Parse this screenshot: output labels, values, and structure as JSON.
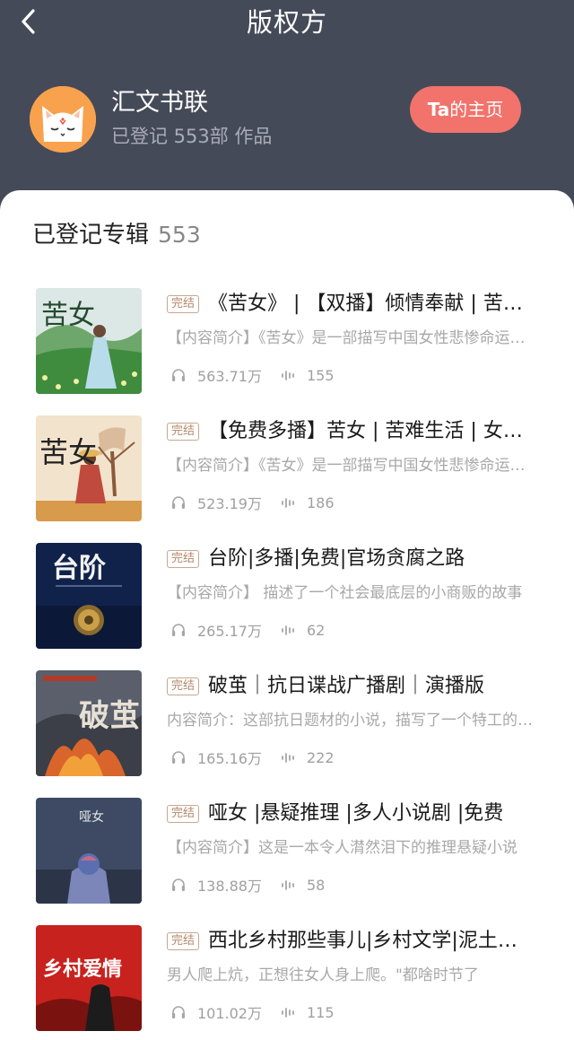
{
  "header": {
    "title": "版权方",
    "owner_name": "汇文书联",
    "owner_registered": "已登记 553部 作品",
    "home_button_bold": "Ta",
    "home_button_rest": "的主页"
  },
  "section": {
    "title": "已登记专辑",
    "count": "553"
  },
  "colors": {
    "header_bg": "#454a59",
    "accent_button": "#f1736b",
    "avatar_bg": "#f8a24e",
    "badge_border": "#c9a68d"
  },
  "icons": {
    "back": "chevron-left-icon",
    "plays": "headphones-icon",
    "tracks": "audio-wave-icon"
  },
  "albums": [
    {
      "badge": "完结",
      "title": "《苦女》 | 【双播】倾情奉献 | 苦难生活",
      "desc": "【内容简介】《苦女》是一部描写中国女性悲惨命运的小说",
      "plays": "563.71万",
      "tracks": "155",
      "cover_text": "苦女"
    },
    {
      "badge": "完结",
      "title": "【免费多播】苦女 | 苦难生活 | 女性命运",
      "desc": "【内容简介】《苦女》是一部描写中国女性悲惨命运的小说",
      "plays": "523.19万",
      "tracks": "186",
      "cover_text": "苦女"
    },
    {
      "badge": "完结",
      "title": "台阶|多播|免费|官场贪腐之路",
      "desc": "【内容简介】 描述了一个社会最底层的小商贩的故事",
      "plays": "265.17万",
      "tracks": "62",
      "cover_text": "台阶"
    },
    {
      "badge": "完结",
      "title": "破茧｜抗日谍战广播剧｜演播版",
      "desc": "内容简介：这部抗日题材的小说，描写了一个特工的故事",
      "plays": "165.16万",
      "tracks": "222",
      "cover_text": "破茧"
    },
    {
      "badge": "完结",
      "title": "哑女 |悬疑推理 |多人小说剧 |免费",
      "desc": "【内容简介】这是一本令人潸然泪下的推理悬疑小说",
      "plays": "138.88万",
      "tracks": "58",
      "cover_text": "哑女"
    },
    {
      "badge": "完结",
      "title": "西北乡村那些事儿|乡村文学|泥土气息",
      "desc": "男人爬上炕，正想往女人身上爬。\"都啥时节了",
      "plays": "101.02万",
      "tracks": "115",
      "cover_text": "乡村爱情"
    }
  ]
}
